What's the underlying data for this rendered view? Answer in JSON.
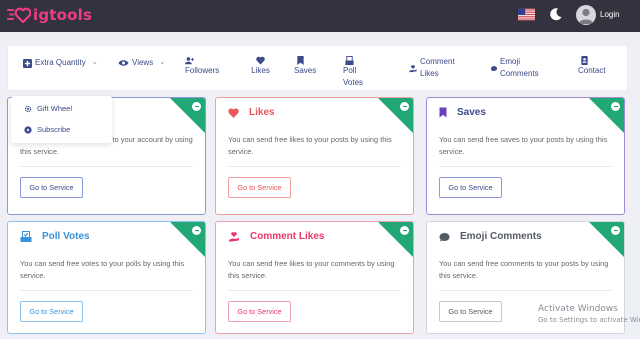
{
  "header": {
    "logo_text": "igtools",
    "login_label": "Login",
    "icons": {
      "logo": "heart-logo-icon",
      "language": "us-flag-icon",
      "theme": "moon-icon",
      "user": "user-avatar-icon"
    },
    "colors": {
      "bar": "#33333f",
      "brand": "#ee3c84"
    }
  },
  "nav": {
    "extra_quantity": "Extra Quantity",
    "views": "Views",
    "followers": "Followers",
    "likes": "Likes",
    "saves": "Saves",
    "poll_votes": "Poll Votes",
    "comment_likes": "Comment Likes",
    "emoji_comments": "Emoji Comments",
    "contact": "Contact"
  },
  "dropdown": {
    "items": [
      "Gift Wheel",
      "Subscribe"
    ]
  },
  "cards": [
    {
      "title": "",
      "desc": "You can send free followers to your account by using this service.",
      "button": "Go to Service",
      "color": "#7c8ad6",
      "icon": "user-plus-icon"
    },
    {
      "title": "Likes",
      "desc": "You can send free likes to your posts by using this service.",
      "button": "Go to Service",
      "color": "#e8575a",
      "icon": "heart-icon"
    },
    {
      "title": "Saves",
      "desc": "You can send free saves to your posts by using this service.",
      "button": "Go to Service",
      "color": "#6a41b8",
      "icon": "bookmark-icon"
    },
    {
      "title": "Poll Votes",
      "desc": "You can send free votes to your polls by using this service.",
      "button": "Go to Service",
      "color": "#3a93d8",
      "icon": "poll-check-icon"
    },
    {
      "title": "Comment Likes",
      "desc": "You can send free likes to your comments by using this service.",
      "button": "Go to Service",
      "color": "#e8376a",
      "icon": "hand-heart-icon"
    },
    {
      "title": "Emoji Comments",
      "desc": "You can send free comments to your posts by using this service.",
      "button": "Go to Service",
      "color": "#555a66",
      "icon": "comment-icon"
    }
  ],
  "watermark": {
    "line1": "Activate Windows",
    "line2": "Go to Settings to activate Windows."
  }
}
